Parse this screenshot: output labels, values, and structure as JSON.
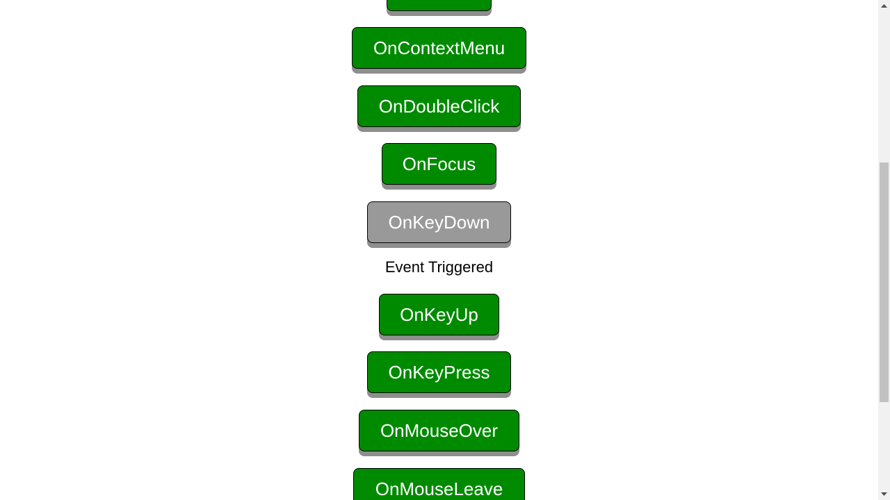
{
  "buttons": [
    {
      "label": "",
      "state": "normal"
    },
    {
      "label": "OnContextMenu",
      "state": "normal"
    },
    {
      "label": "OnDoubleClick",
      "state": "normal"
    },
    {
      "label": "OnFocus",
      "state": "normal"
    },
    {
      "label": "OnKeyDown",
      "state": "triggered"
    },
    {
      "label": "OnKeyUp",
      "state": "normal"
    },
    {
      "label": "OnKeyPress",
      "state": "normal"
    },
    {
      "label": "OnMouseOver",
      "state": "normal"
    },
    {
      "label": "OnMouseLeave",
      "state": "normal"
    }
  ],
  "status": {
    "event_text": "Event Triggered"
  },
  "colors": {
    "button_active": "#008a00",
    "button_triggered": "#999999",
    "button_shadow": "#8e8e8e",
    "text_on_button": "#ffffff"
  },
  "icons": {
    "scroll_up": "chevron-up-icon",
    "scroll_down": "chevron-down-icon"
  }
}
